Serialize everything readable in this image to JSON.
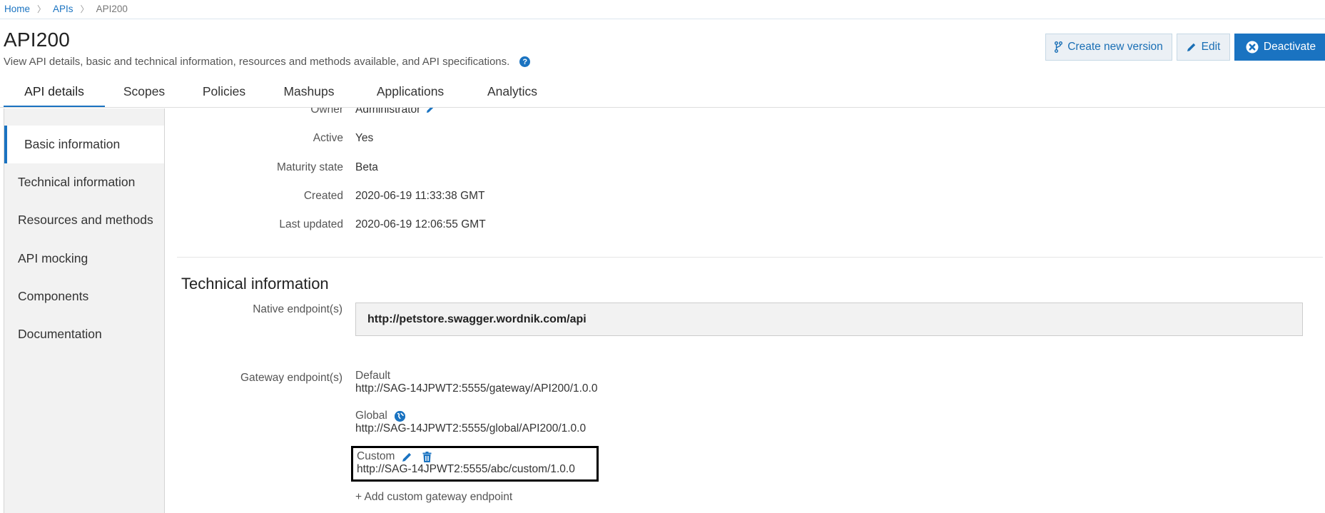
{
  "breadcrumb": [
    {
      "label": "Home",
      "link": true
    },
    {
      "label": "APIs",
      "link": true
    },
    {
      "label": "API200",
      "link": false
    }
  ],
  "breadcrumb_separator": "〉",
  "header": {
    "title": "API200",
    "description": "View API details, basic and technical information, resources and methods available, and API specifications.",
    "help_icon": "?"
  },
  "actions": {
    "create_version": "Create new version",
    "edit": "Edit",
    "deactivate": "Deactivate"
  },
  "tabs": [
    {
      "label": "API details",
      "active": true
    },
    {
      "label": "Scopes",
      "active": false
    },
    {
      "label": "Policies",
      "active": false
    },
    {
      "label": "Mashups",
      "active": false
    },
    {
      "label": "Applications",
      "active": false
    },
    {
      "label": "Analytics",
      "active": false
    }
  ],
  "sidebar": {
    "items": [
      {
        "label": "Basic information",
        "active": true
      },
      {
        "label": "Technical information",
        "active": false
      },
      {
        "label": "Resources and methods",
        "active": false
      },
      {
        "label": "API mocking",
        "active": false
      },
      {
        "label": "Components",
        "active": false
      },
      {
        "label": "Documentation",
        "active": false
      }
    ]
  },
  "basic_info": {
    "rows": [
      {
        "label": "Owner",
        "value": "Administrator",
        "editable": true
      },
      {
        "label": "Active",
        "value": "Yes"
      },
      {
        "label": "Maturity state",
        "value": "Beta"
      },
      {
        "label": "Created",
        "value": "2020-06-19 11:33:38 GMT"
      },
      {
        "label": "Last updated",
        "value": "2020-06-19 12:06:55 GMT"
      }
    ]
  },
  "technical_info": {
    "title": "Technical information",
    "native_label": "Native endpoint(s)",
    "native_endpoint": "http://petstore.swagger.wordnik.com/api",
    "gateway_label": "Gateway endpoint(s)",
    "gateways": [
      {
        "name": "Default",
        "url": "http://SAG-14JPWT2:5555/gateway/API200/1.0.0"
      },
      {
        "name": "Global",
        "url": "http://SAG-14JPWT2:5555/global/API200/1.0.0",
        "icon": "globe-icon"
      },
      {
        "name": "Custom",
        "url": "http://SAG-14JPWT2:5555/abc/custom/1.0.0",
        "icons": [
          "pencil-icon",
          "trash-icon"
        ]
      }
    ],
    "add_link": "+ Add custom gateway endpoint"
  },
  "colors": {
    "accent": "#1a73c1",
    "sidebar_bg": "#f2f2f2",
    "button_light_bg": "#ebf0f5",
    "highlight_border": "#000000"
  }
}
